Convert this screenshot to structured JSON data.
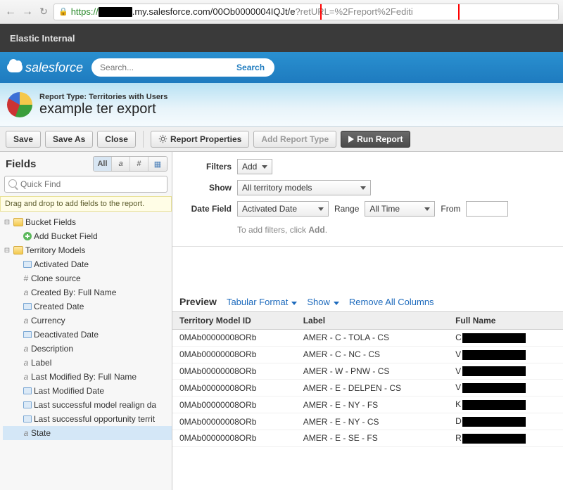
{
  "browser": {
    "url_prefix_https": "https://",
    "url_domain": ".my.salesforce.c",
    "url_highlight": "om/00Ob0000004IQJt/e",
    "url_rest": "?retURL=%2Freport%2Fediti"
  },
  "elastic_bar": {
    "label": "Elastic Internal"
  },
  "sf_header": {
    "logo_text": "salesforce",
    "search_placeholder": "Search...",
    "search_btn": "Search"
  },
  "report_band": {
    "type_label": "Report Type: Territories with Users",
    "title": "example ter export"
  },
  "toolbar": {
    "save": "Save",
    "save_as": "Save As",
    "close": "Close",
    "report_props": "Report Properties",
    "add_type": "Add Report Type",
    "run": "Run Report"
  },
  "fields_panel": {
    "heading": "Fields",
    "tabs": {
      "all": "All",
      "a": "a",
      "hash": "#",
      "date": "▦"
    },
    "quickfind_placeholder": "Quick Find",
    "drag_hint": "Drag and drop to add fields to the report.",
    "bucket_folder": "Bucket Fields",
    "add_bucket": "Add Bucket Field",
    "territory_folder": "Territory Models",
    "items": [
      {
        "type": "d",
        "label": "Activated Date"
      },
      {
        "type": "h",
        "label": "Clone source"
      },
      {
        "type": "a",
        "label": "Created By: Full Name"
      },
      {
        "type": "d",
        "label": "Created Date"
      },
      {
        "type": "a",
        "label": "Currency"
      },
      {
        "type": "d",
        "label": "Deactivated Date"
      },
      {
        "type": "a",
        "label": "Description"
      },
      {
        "type": "a",
        "label": "Label"
      },
      {
        "type": "a",
        "label": "Last Modified By: Full Name"
      },
      {
        "type": "d",
        "label": "Last Modified Date"
      },
      {
        "type": "d",
        "label": "Last successful model realign da"
      },
      {
        "type": "d",
        "label": "Last successful opportunity territ"
      },
      {
        "type": "a",
        "label": "State",
        "selected": true
      }
    ]
  },
  "filters": {
    "filters_label": "Filters",
    "add_btn": "Add",
    "show_label": "Show",
    "show_value": "All territory models",
    "datefield_label": "Date Field",
    "datefield_value": "Activated Date",
    "range_label": "Range",
    "range_value": "All Time",
    "from_label": "From",
    "add_hint_pre": "To add filters, click ",
    "add_hint_bold": "Add",
    "add_hint_post": "."
  },
  "preview": {
    "heading": "Preview",
    "format": "Tabular Format",
    "show": "Show",
    "remove": "Remove All Columns",
    "cols": {
      "c1": "Territory Model ID",
      "c2": "Label",
      "c3": "Full Name"
    },
    "rows": [
      {
        "id": "0MAb00000008ORb",
        "label": "AMER - C - TOLA - CS",
        "pre": "C"
      },
      {
        "id": "0MAb00000008ORb",
        "label": "AMER - C - NC - CS",
        "pre": "V"
      },
      {
        "id": "0MAb00000008ORb",
        "label": "AMER - W - PNW - CS",
        "pre": "V"
      },
      {
        "id": "0MAb00000008ORb",
        "label": "AMER - E - DELPEN - CS",
        "pre": "V"
      },
      {
        "id": "0MAb00000008ORb",
        "label": "AMER - E - NY - FS",
        "pre": "K"
      },
      {
        "id": "0MAb00000008ORb",
        "label": "AMER - E - NY - CS",
        "pre": "D"
      },
      {
        "id": "0MAb00000008ORb",
        "label": "AMER - E - SE - FS",
        "pre": "R"
      }
    ]
  }
}
